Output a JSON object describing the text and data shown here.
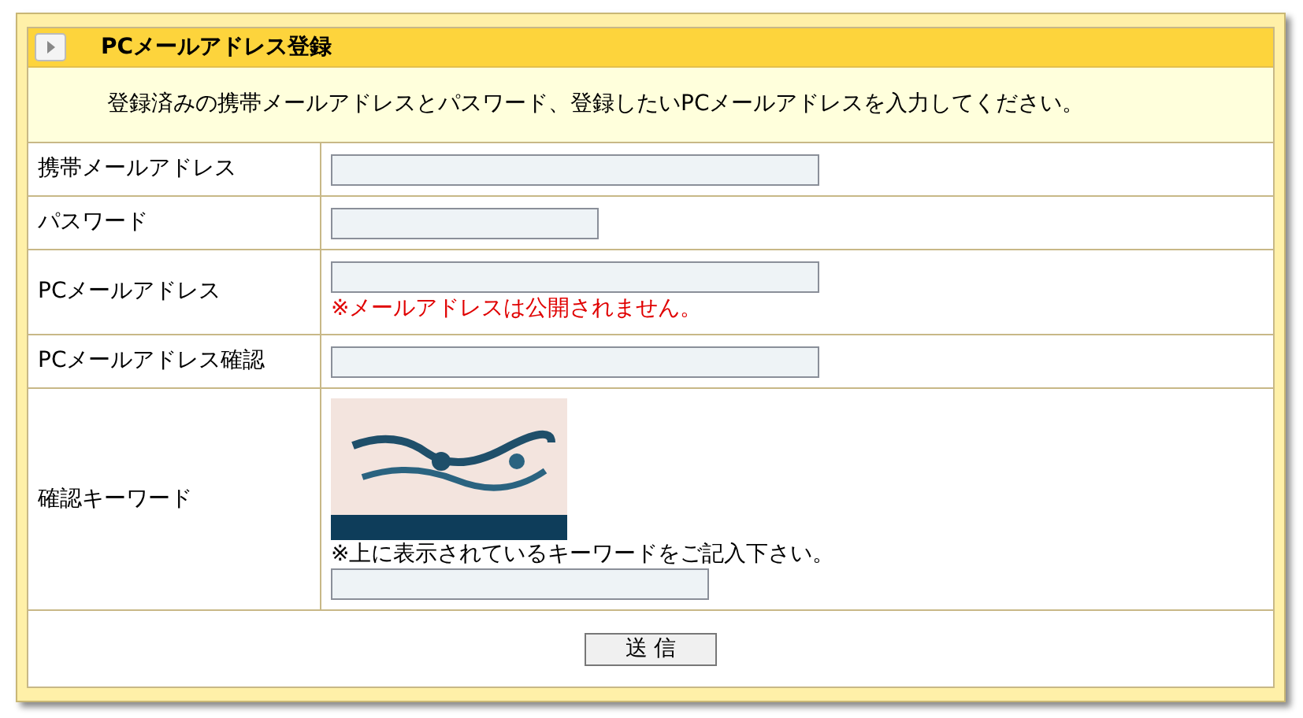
{
  "title": "PCメールアドレス登録",
  "description": "登録済みの携帯メールアドレスとパスワード、登録したいPCメールアドレスを入力してください。",
  "rows": [
    {
      "label": "携帯メールアドレス",
      "kind": "email"
    },
    {
      "label": "パスワード",
      "kind": "password"
    },
    {
      "label": "PCメールアドレス",
      "kind": "email",
      "note": "※メールアドレスは公開されません。"
    },
    {
      "label": "PCメールアドレス確認",
      "kind": "email"
    },
    {
      "label": "確認キーワード",
      "kind": "captcha",
      "note": "※上に表示されているキーワードをご記入下さい。"
    }
  ],
  "submit": "送 信"
}
